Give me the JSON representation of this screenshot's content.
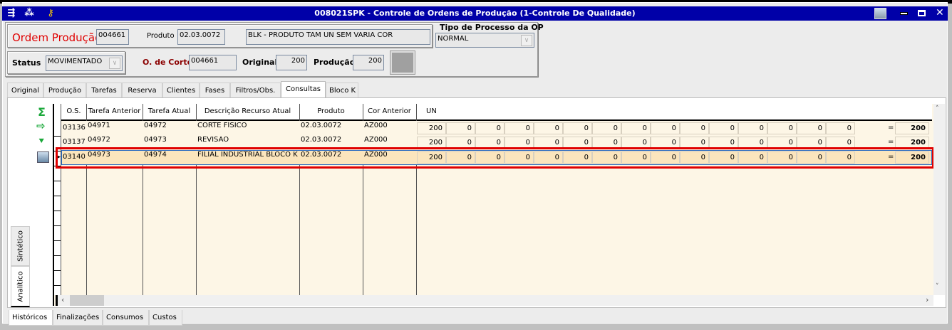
{
  "window": {
    "title": "008021SPK - Controle de Ordens de Produção (1-Controle De Qualidade)"
  },
  "icons": {
    "left": [
      "export-icon",
      "traffic-light-icon",
      "key-icon"
    ],
    "right": [
      "image-icon",
      "minimize-icon",
      "maximize-icon",
      "close-icon"
    ]
  },
  "header": {
    "ordem_label": "Ordem Produção",
    "ordem_value": "004661",
    "produto_label": "Produto",
    "produto_code": "02.03.0072",
    "produto_desc": "BLK - PRODUTO TAM UN SEM VARIA COR",
    "tipo_label": "Tipo de Processo da OP",
    "tipo_value": "NORMAL",
    "status_label": "Status",
    "status_value": "MOVIMENTADO",
    "corte_label": "O. de Corte",
    "corte_value": "004661",
    "original_label": "Original",
    "original_value": "200",
    "producao_label": "Produção",
    "producao_value": "200"
  },
  "tabs": [
    "Original",
    "Produção",
    "Tarefas",
    "Reserva",
    "Clientes",
    "Fases",
    "Filtros/Obs.",
    "Consultas",
    "Bloco K"
  ],
  "active_tab": "Consultas",
  "side_tabs": [
    "Sintético",
    "Analítico"
  ],
  "bottom_tabs": [
    "Históricos",
    "Finalizações",
    "Consumos",
    "Custos"
  ],
  "grid": {
    "columns": [
      "O.S.",
      "Tarefa Anterior",
      "Tarefa Atual",
      "Descrição Recurso Atual",
      "Produto",
      "Cor Anterior",
      "UN"
    ],
    "rows": [
      {
        "os": "03136",
        "ant": "04971",
        "atual": "04972",
        "desc": "CORTE FÍSICO",
        "prod": "02.03.0072",
        "cor": "AZ000",
        "qty": [
          "200",
          "0",
          "0",
          "0",
          "0",
          "0",
          "0",
          "0",
          "0",
          "0",
          "0",
          "0",
          "0",
          "0",
          "0"
        ],
        "eq": "=",
        "total": "200"
      },
      {
        "os": "03137",
        "ant": "04972",
        "atual": "04973",
        "desc": "REVISÃO",
        "prod": "02.03.0072",
        "cor": "AZ000",
        "qty": [
          "200",
          "0",
          "0",
          "0",
          "0",
          "0",
          "0",
          "0",
          "0",
          "0",
          "0",
          "0",
          "0",
          "0",
          "0"
        ],
        "eq": "=",
        "total": "200"
      },
      {
        "os": "03140",
        "ant": "04973",
        "atual": "04974",
        "desc": "FILIAL INDUSTRIAL BLOCO K",
        "prod": "02.03.0072",
        "cor": "AZ000",
        "qty": [
          "200",
          "0",
          "0",
          "0",
          "0",
          "0",
          "0",
          "0",
          "0",
          "0",
          "0",
          "0",
          "0",
          "0",
          "0"
        ],
        "eq": "=",
        "total": "200"
      }
    ]
  },
  "colors": {
    "title_bar": "#0000a8",
    "row_bg": "#fdf6e6",
    "selected_bg": "#fbe5bd",
    "highlight": "#e00000"
  }
}
